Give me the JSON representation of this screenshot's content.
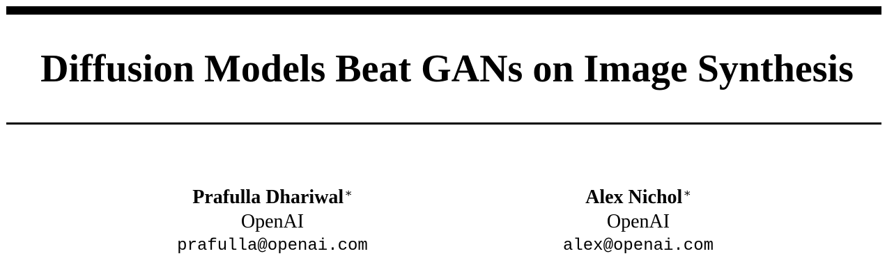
{
  "title": "Diffusion Models Beat GANs on Image Synthesis",
  "authors": [
    {
      "name": "Prafulla Dhariwal",
      "mark": "∗",
      "affiliation": "OpenAI",
      "email": "prafulla@openai.com"
    },
    {
      "name": "Alex Nichol",
      "mark": "∗",
      "affiliation": "OpenAI",
      "email": "alex@openai.com"
    }
  ]
}
